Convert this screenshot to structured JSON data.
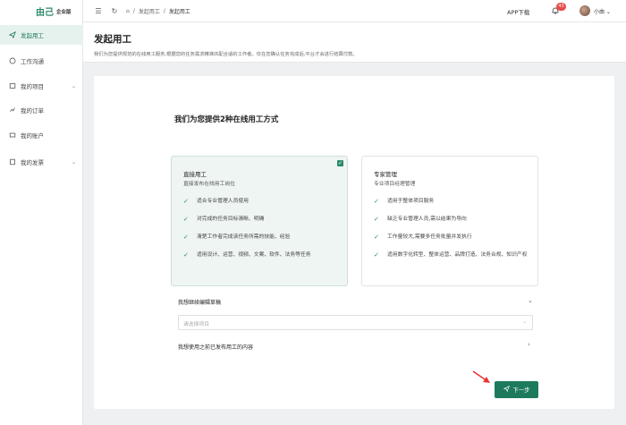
{
  "sidebar": {
    "brand": "由己",
    "edition": "企业版",
    "items": [
      {
        "label": "发起用工",
        "icon": "paper-plane-icon"
      },
      {
        "label": "工作沟通",
        "icon": "chat-icon"
      },
      {
        "label": "我的项目",
        "icon": "folder-icon",
        "expandable": true
      },
      {
        "label": "我的订单",
        "icon": "order-icon"
      },
      {
        "label": "我的账户",
        "icon": "wallet-icon"
      },
      {
        "label": "我的发票",
        "icon": "invoice-icon",
        "expandable": true
      }
    ]
  },
  "topbar": {
    "breadcrumb": [
      "发起用工",
      "发起用工"
    ],
    "app_download": "APP下载",
    "notification_count": "43",
    "username": "小由"
  },
  "header": {
    "title": "发起用工",
    "description": "我们为您提供规范的在线用工服务,根据您的任务需求精准匹配合适的工作者。仅在您确认任务完成后,平台才会进行结算付款。"
  },
  "main": {
    "title": "我们为您提供2种在线用工方式",
    "options": [
      {
        "title": "直接用工",
        "subtitle": "直接发布在线用工岗位",
        "selected": true,
        "features": [
          "适合专业管理人员使用",
          "对完成的任务目标清晰、明确",
          "清楚工作者完成该任务所需的技能、经验",
          "适用设计、运营、视频、文案、软件、法务等任务"
        ]
      },
      {
        "title": "专家管理",
        "subtitle": "专业项目经理管理",
        "selected": false,
        "features": [
          "适用于整体项目服务",
          "缺乏专业管理人员,需以结果为导向",
          "工作量较大,需要多任务批量并发执行",
          "适用数字化转型、整体运营、品牌打造、法务合规、知识产权"
        ]
      }
    ],
    "continue_label": "我想继续编辑草稿",
    "select_placeholder": "请选择项目",
    "reuse_label": "我想使用之前已发布用工的内容",
    "next_label": "下一步"
  },
  "colors": {
    "accent": "#2e8b6e",
    "button": "#1d7a5c",
    "badge": "#e84a4a",
    "active_bg": "#e6f2ee"
  }
}
